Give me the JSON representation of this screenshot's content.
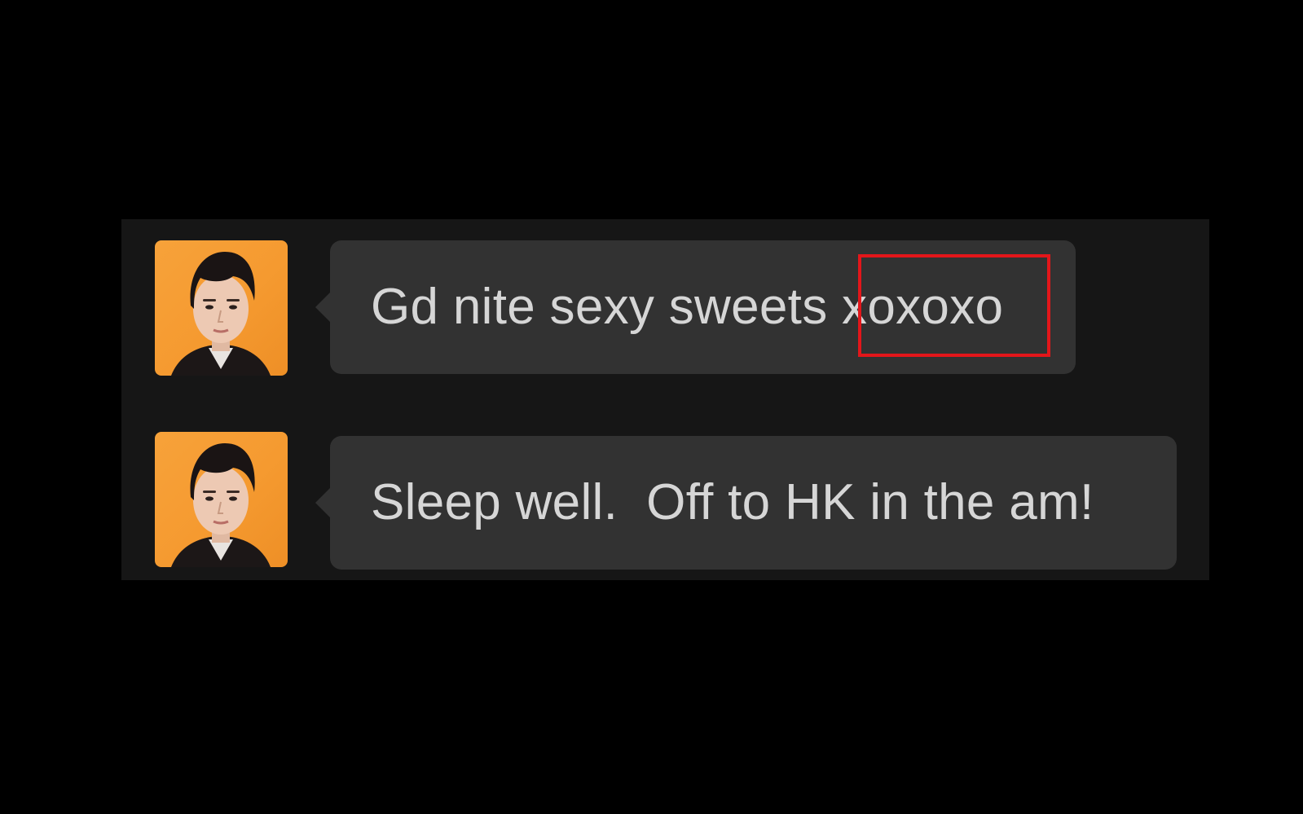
{
  "conversation": {
    "messages": [
      {
        "avatar_icon": "person-avatar-icon",
        "text_main": "Gd nite sexy sweets ",
        "text_highlight": "xoxoxo",
        "highlight_color": "#e3161a"
      },
      {
        "avatar_icon": "person-avatar-icon",
        "text_main": "Sleep well.  Off to HK in the am!"
      }
    ]
  },
  "colors": {
    "background": "#000000",
    "panel": "#161616",
    "bubble": "#323232",
    "text": "#d6d6d6",
    "avatar_bg": "#f59a30"
  }
}
